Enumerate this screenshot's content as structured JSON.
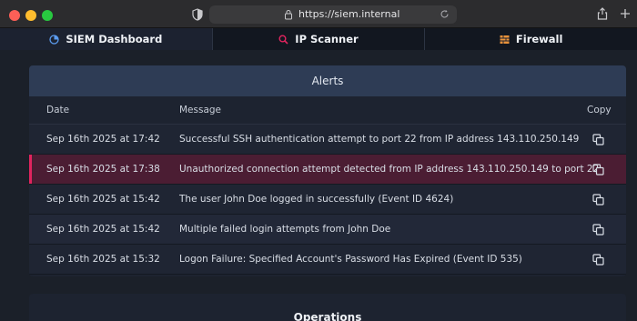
{
  "browser": {
    "url": "https://siem.internal"
  },
  "tabs": [
    {
      "label": "SIEM Dashboard",
      "icon": "dashboard-icon",
      "active": true
    },
    {
      "label": "IP Scanner",
      "icon": "search-icon",
      "active": false
    },
    {
      "label": "Firewall",
      "icon": "firewall-icon",
      "active": false
    }
  ],
  "alerts": {
    "title": "Alerts",
    "columns": {
      "date": "Date",
      "message": "Message",
      "copy": "Copy"
    },
    "rows": [
      {
        "date": "Sep 16th 2025 at 17:42",
        "message": "Successful SSH authentication attempt to port 22 from IP address 143.110.250.149"
      },
      {
        "date": "Sep 16th 2025 at 17:38",
        "message": "Unauthorized connection attempt detected from IP address 143.110.250.149 to port 22",
        "highlighted": true
      },
      {
        "date": "Sep 16th 2025 at 15:42",
        "message": "The user John Doe logged in successfully (Event ID 4624)"
      },
      {
        "date": "Sep 16th 2025 at 15:42",
        "message": "Multiple failed login attempts from John Doe"
      },
      {
        "date": "Sep 16th 2025 at 15:32",
        "message": "Logon Failure: Specified Account's Password Has Expired (Event ID 535)"
      }
    ]
  },
  "operations": {
    "title": "Operations"
  },
  "colors": {
    "accent": "#e0245e",
    "header": "#2e3c55",
    "highlight_row": "#4b1d33"
  }
}
